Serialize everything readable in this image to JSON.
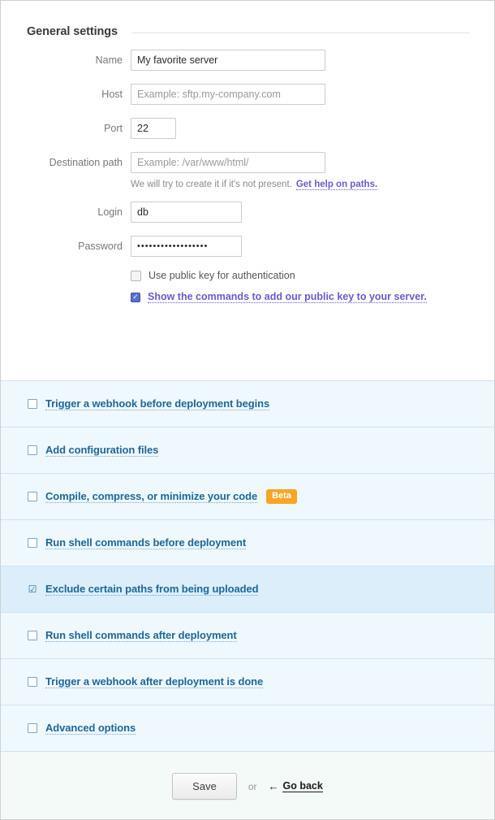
{
  "general": {
    "section_title": "General settings",
    "fields": [
      {
        "label": "Name",
        "value": "My favorite server",
        "placeholder": ""
      },
      {
        "label": "Host",
        "value": "",
        "placeholder": "Example: sftp.my-company.com"
      },
      {
        "label": "Port",
        "value": "22",
        "placeholder": ""
      },
      {
        "label": "Destination path",
        "value": "",
        "placeholder": "Example: /var/www/html/"
      },
      {
        "label": "Login",
        "value": "db",
        "placeholder": ""
      },
      {
        "label": "Password",
        "value": "••••••••••••••••••",
        "placeholder": ""
      }
    ],
    "helper_text": "We will try to create it if it's not present.",
    "helper_link": "Get help on paths.",
    "public_key_checkbox": {
      "label": "Use public key for authentication",
      "checked": false
    },
    "show_commands_link": {
      "label": "Show the commands to add our public key to your server.",
      "checked": true,
      "check_glyph": "✓"
    }
  },
  "accordion": {
    "rows": [
      {
        "label": "Trigger a webhook before deployment begins",
        "checked": false,
        "badge": "",
        "active": false
      },
      {
        "label": "Add configuration files",
        "checked": false,
        "badge": "",
        "active": false
      },
      {
        "label": "Compile, compress, or minimize your code",
        "checked": false,
        "badge": "Beta",
        "active": false
      },
      {
        "label": "Run shell commands before deployment",
        "checked": false,
        "badge": "",
        "active": false
      },
      {
        "label": "Exclude certain paths from being uploaded",
        "checked": true,
        "badge": "",
        "active": true
      },
      {
        "label": "Run shell commands after deployment",
        "checked": false,
        "badge": "",
        "active": false
      },
      {
        "label": "Trigger a webhook after deployment is done",
        "checked": false,
        "badge": "",
        "active": false
      },
      {
        "label": "Advanced options",
        "checked": false,
        "badge": "",
        "active": false
      }
    ],
    "check_glyph": "☑"
  },
  "footer": {
    "save_label": "Save",
    "or_label": "or",
    "back_arrow": "←",
    "back_label": "Go back"
  },
  "colors": {
    "accent_link": "#1d6799",
    "violet_link": "#6a5acd",
    "badge_orange": "#f5a623",
    "row_bg": "#eff8fd",
    "row_bg_active": "#dbeefa",
    "footer_bg": "#f4faf7"
  }
}
